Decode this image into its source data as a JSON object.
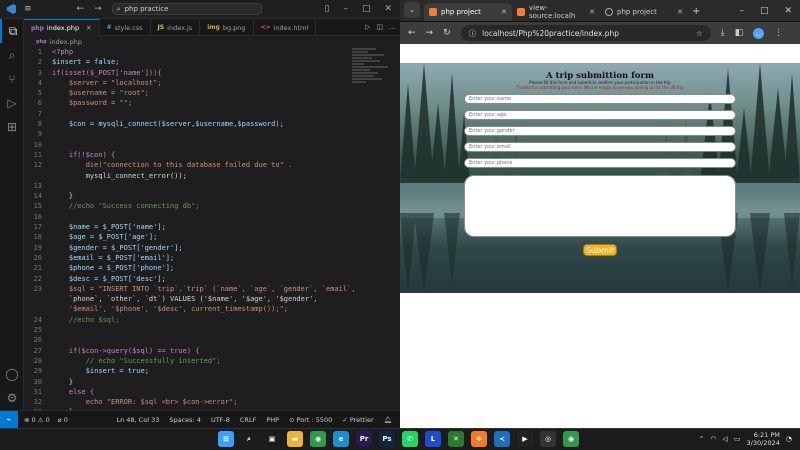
{
  "vscode": {
    "search": "php practice",
    "tabs": [
      {
        "icon": "php",
        "label": "index.php",
        "color": "#a074c4",
        "active": true
      },
      {
        "icon": "#",
        "label": "style.css",
        "color": "#42a5f5",
        "active": false
      },
      {
        "icon": "JS",
        "label": "index.js",
        "color": "#cbcb41",
        "active": false
      },
      {
        "icon": "img",
        "label": "bg.png",
        "color": "#d4a54a",
        "active": false
      },
      {
        "icon": "<>",
        "label": "index.html",
        "color": "#e44d26",
        "active": false
      }
    ],
    "breadcrumb": "index.php",
    "lines": [
      {
        "n": "1",
        "t": "<?php"
      },
      {
        "n": "2",
        "t": "$insert = false;"
      },
      {
        "n": "3",
        "t": "if(isset($_POST['name'])){"
      },
      {
        "n": "4",
        "t": "    $server = \"localhost\";"
      },
      {
        "n": "5",
        "t": "    $username = \"root\";"
      },
      {
        "n": "6",
        "t": "    $password = \"\";"
      },
      {
        "n": "7",
        "t": ""
      },
      {
        "n": "8",
        "t": "    $con = mysqli_connect($server,$username,$password);"
      },
      {
        "n": "9",
        "t": ""
      },
      {
        "n": "10",
        "t": ""
      },
      {
        "n": "11",
        "t": "    if(!$con) {"
      },
      {
        "n": "12",
        "t": "        die(\"connection to this database failed due to\" ."
      },
      {
        "n": "",
        "t": "        mysqli_connect_error());"
      },
      {
        "n": "13",
        "t": ""
      },
      {
        "n": "14",
        "t": "    }"
      },
      {
        "n": "15",
        "t": "    //echo \"Success connecting db\";"
      },
      {
        "n": "16",
        "t": ""
      },
      {
        "n": "17",
        "t": "    $name = $_POST['name'];"
      },
      {
        "n": "18",
        "t": "    $age = $_POST['age'];"
      },
      {
        "n": "19",
        "t": "    $gender = $_POST['gender'];"
      },
      {
        "n": "20",
        "t": "    $email = $_POST['email'];"
      },
      {
        "n": "21",
        "t": "    $phone = $_POST['phone'];"
      },
      {
        "n": "22",
        "t": "    $desc = $_POST['desc'];"
      },
      {
        "n": "23",
        "t": "    $sql = \"INSERT INTO `trip`.`trip` (`name`, `age`, `gender`, `email`,"
      },
      {
        "n": "",
        "t": "    `phone`, `other`, `dt`) VALUES ('$name', '$age', '$gender',"
      },
      {
        "n": "",
        "t": "    '$email', '$phone', '$desc', current_timestamp());\";"
      },
      {
        "n": "24",
        "t": "    //echo $sql;"
      },
      {
        "n": "25",
        "t": ""
      },
      {
        "n": "26",
        "t": ""
      },
      {
        "n": "27",
        "t": "    if($con->query($sql) == true) {"
      },
      {
        "n": "28",
        "t": "        // echo \"Successfully inserted\";"
      },
      {
        "n": "29",
        "t": "        $insert = true;"
      },
      {
        "n": "30",
        "t": "    }"
      },
      {
        "n": "31",
        "t": "    else {"
      },
      {
        "n": "32",
        "t": "        echo \"ERROR: $sql <br> $con->error\";"
      },
      {
        "n": "33",
        "t": "    }"
      },
      {
        "n": "34",
        "t": ""
      }
    ],
    "status": {
      "errors": "⊗ 0 ⚠ 0",
      "ports": "⌀ 0",
      "position": "Ln 48, Col 33",
      "spaces": "Spaces: 4",
      "encoding": "UTF-8",
      "eol": "CRLF",
      "lang": "PHP",
      "port": "⊙ Port : 5500",
      "prettier": "✓ Prettier"
    }
  },
  "browser": {
    "tabs": [
      {
        "label": "php project",
        "active": true,
        "fav": "orange"
      },
      {
        "label": "view-source:localh",
        "active": false,
        "fav": "orange"
      },
      {
        "label": "php project",
        "active": false,
        "fav": "globe"
      }
    ],
    "url": "localhost/Php%20practice/index.php",
    "page": {
      "title": "A trip submittion form",
      "subtitle": "Please fill this form and submit to confirm your participation in the trip",
      "subtitle2": "Thanks for submitting your form. We are happy to see you joining us for the US trip",
      "placeholders": [
        "Enter your name",
        "Enter your age",
        "Enter your gender",
        "Enter your email",
        "Enter your phone"
      ],
      "submit": "Submit"
    }
  },
  "taskbar": {
    "apps": [
      {
        "name": "start-icon",
        "color": "#3aa0ff",
        "glyph": "⊞"
      },
      {
        "name": "search-icon",
        "color": "transparent",
        "glyph": "⌕"
      },
      {
        "name": "task-view-icon",
        "color": "transparent",
        "glyph": "▣"
      },
      {
        "name": "file-explorer-icon",
        "color": "#e8b43a",
        "glyph": "▬"
      },
      {
        "name": "chrome-icon",
        "color": "#2f9b4a",
        "glyph": "◉"
      },
      {
        "name": "edge-icon",
        "color": "#1b8fd2",
        "glyph": "e"
      },
      {
        "name": "premiere-icon",
        "color": "#2a1850",
        "glyph": "Pr"
      },
      {
        "name": "photoshop-icon",
        "color": "#0b2744",
        "glyph": "Ps"
      },
      {
        "name": "whatsapp-icon",
        "color": "#25d366",
        "glyph": "✆"
      },
      {
        "name": "l-app-icon",
        "color": "#1e4bd2",
        "glyph": "L"
      },
      {
        "name": "xbox-icon",
        "color": "#2b7a2b",
        "glyph": "✕"
      },
      {
        "name": "xampp-icon",
        "color": "#f57b20",
        "glyph": "✻"
      },
      {
        "name": "vscode-icon",
        "color": "#1f6fc1",
        "glyph": "≺"
      },
      {
        "name": "media-icon",
        "color": "#222",
        "glyph": "▶"
      },
      {
        "name": "obs-icon",
        "color": "#333",
        "glyph": "◎"
      },
      {
        "name": "chrome-2-icon",
        "color": "#2f9b4a",
        "glyph": "◉"
      }
    ],
    "time": "6:21 PM",
    "date": "3/30/2024"
  }
}
